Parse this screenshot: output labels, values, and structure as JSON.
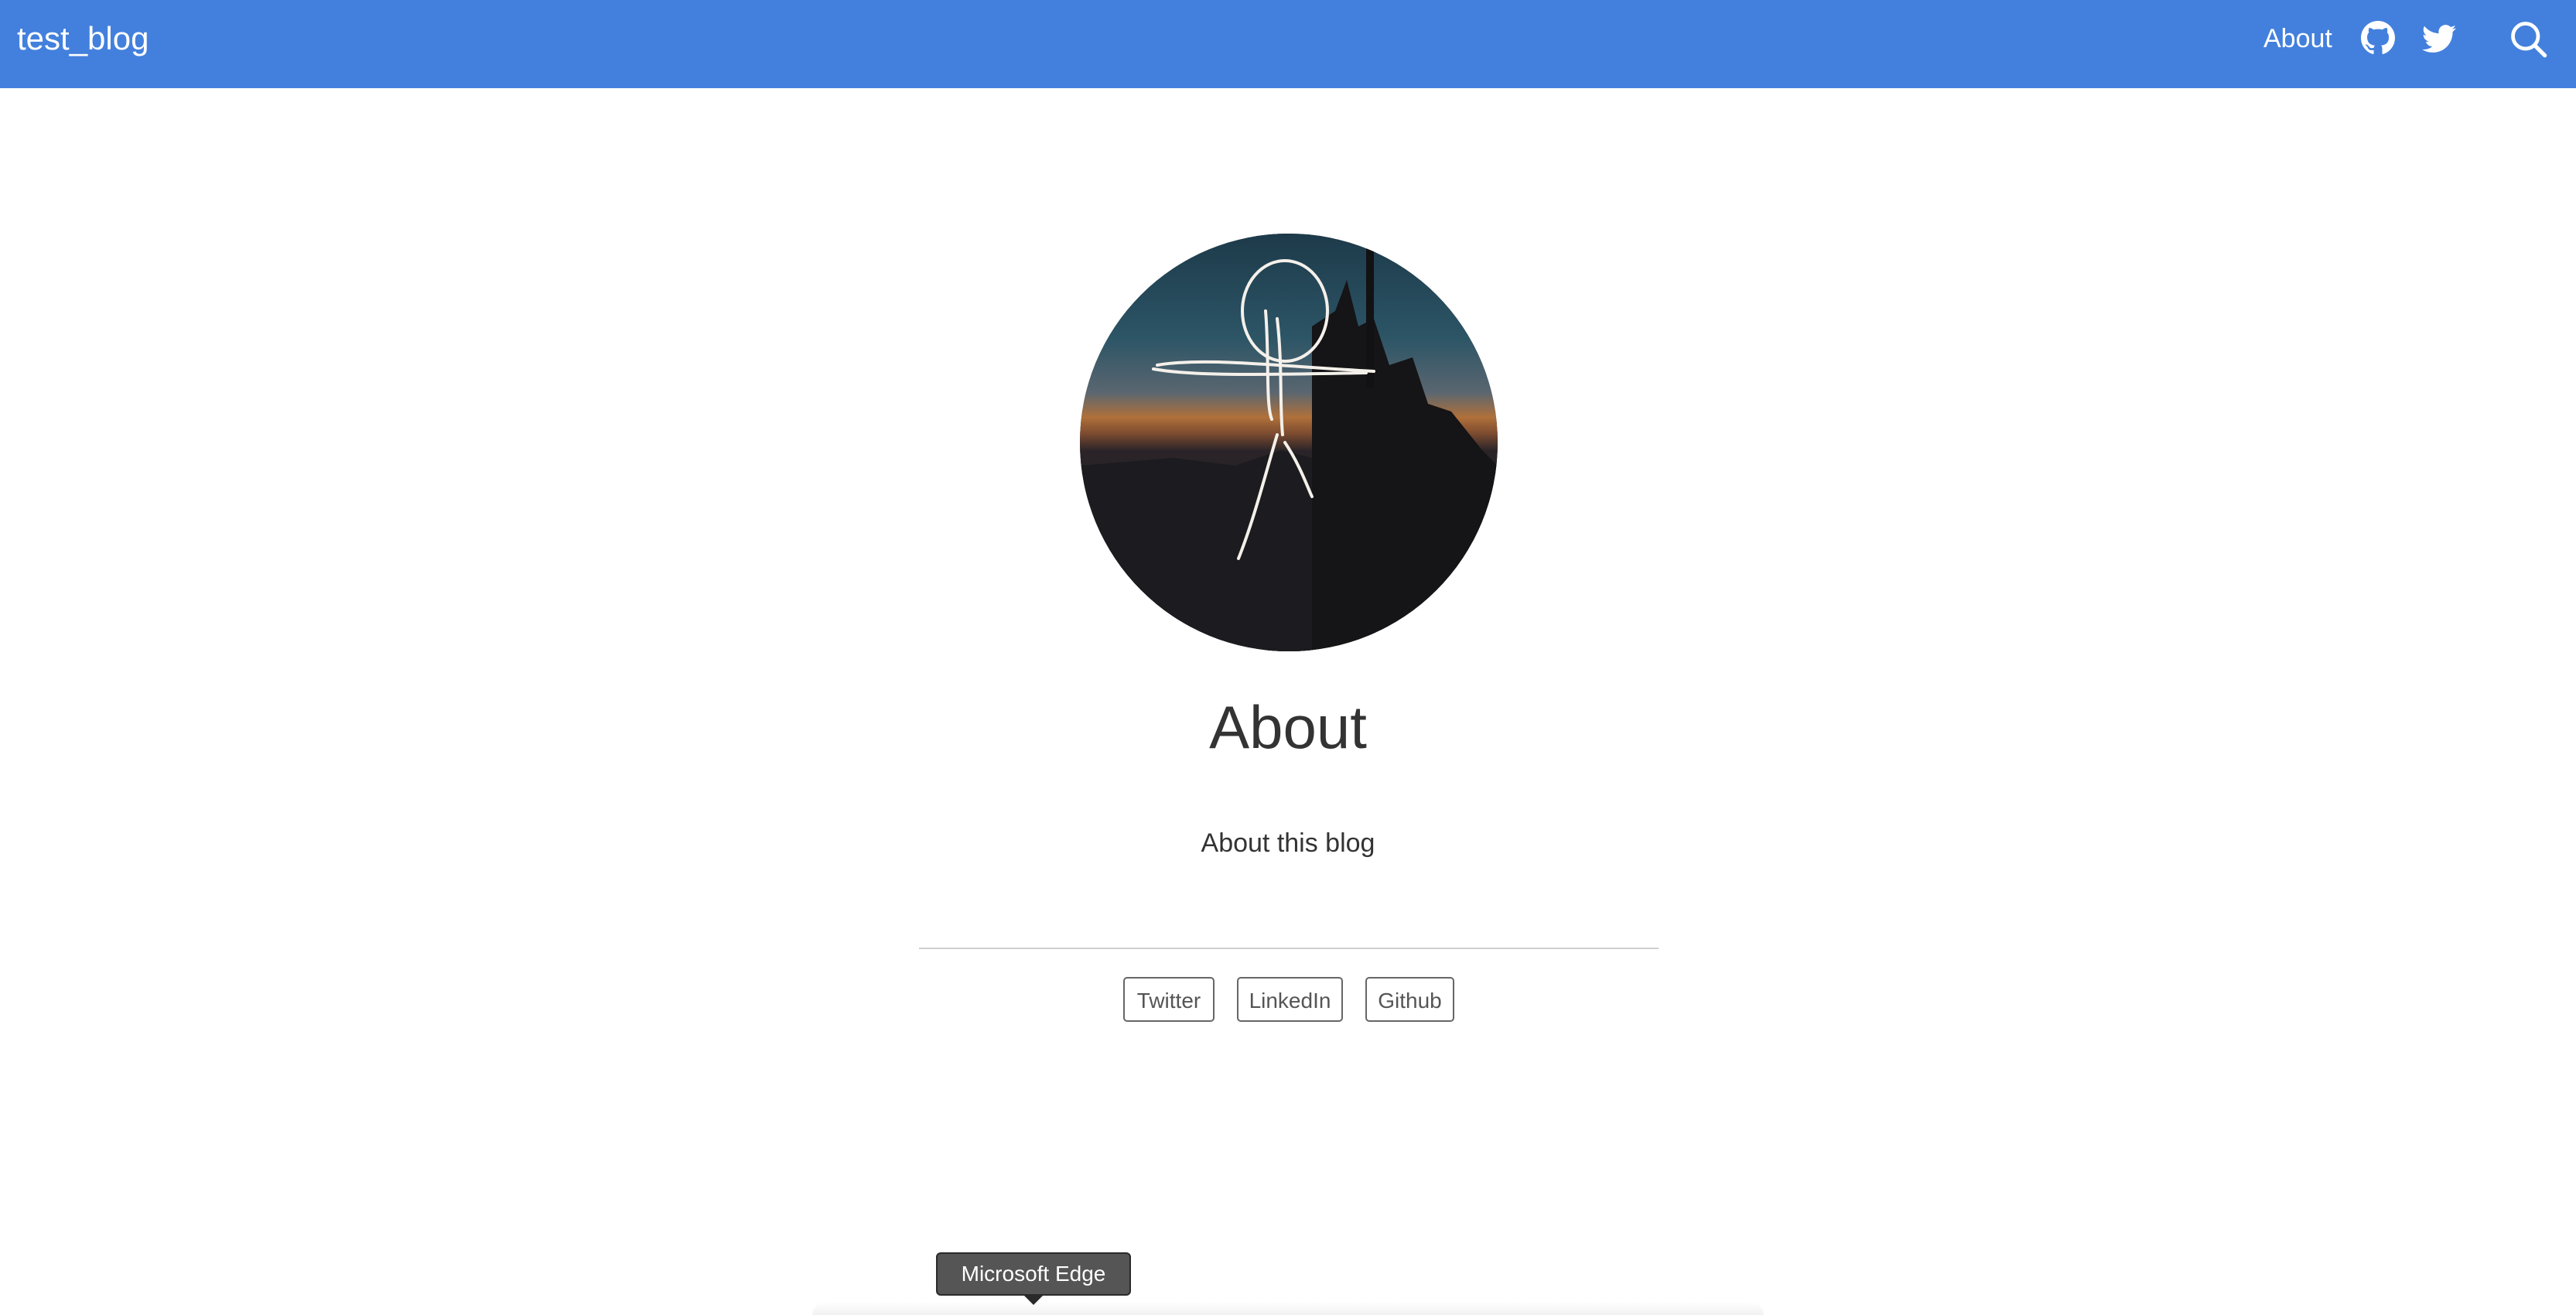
{
  "navbar": {
    "brand": "test_blog",
    "about_link": "About",
    "icons": [
      "github-icon",
      "twitter-icon",
      "search-icon"
    ],
    "background_color": "#4380dd"
  },
  "main": {
    "title": "About",
    "description": "About this blog"
  },
  "social_links": [
    {
      "label": "Twitter"
    },
    {
      "label": "LinkedIn"
    },
    {
      "label": "Github"
    }
  ],
  "tooltip": {
    "text": "Microsoft Edge"
  }
}
